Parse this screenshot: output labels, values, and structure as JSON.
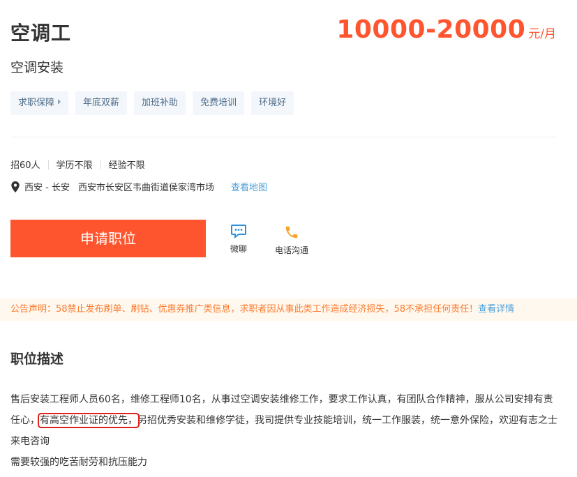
{
  "job": {
    "title": "空调工",
    "salary_amount": "10000-20000",
    "salary_unit": "元/月",
    "category": "空调安装"
  },
  "tags": [
    "求职保障",
    "年底双薪",
    "加班补助",
    "免费培训",
    "环境好"
  ],
  "requirements": {
    "headcount": "招60人",
    "education": "学历不限",
    "experience": "经验不限"
  },
  "location": {
    "area": "西安 - 长安",
    "address": "西安市长安区韦曲街道侯家湾市场",
    "map_link": "查看地图"
  },
  "actions": {
    "apply": "申请职位",
    "wechat": "微聊",
    "phone": "电话沟通"
  },
  "notice": {
    "text": "公告声明：58禁止发布刷单、刷钻、优惠券推广类信息，求职者因从事此类工作造成经济损失，58不承担任何责任！",
    "link": "查看详情"
  },
  "description": {
    "heading": "职位描述",
    "line1_before": "售后安装工程师人员60名，维修工程师10名，从事过空调安装维修工作，要求工作认真，有团队合作精神，服从公司安排有责任心，",
    "line1_highlight": "有高空作业证的优先，",
    "line1_after": "另招优秀安装和维修学徒，我司提供专业技能培训，统一工作服装，统一意外保险，欢迎有志之士来电咨询",
    "line2": "需要较强的吃苦耐劳和抗压能力"
  },
  "colors": {
    "accent": "#ff552e",
    "link": "#4a9ed8",
    "tag_bg": "#f3f7fb",
    "notice_bg": "#fff8ee",
    "highlight_box": "#e0231a"
  },
  "icons": {
    "location": "location-pin-icon",
    "wechat": "chat-bubble-icon",
    "phone": "phone-icon",
    "tag_arrow": "caret-right-icon"
  }
}
